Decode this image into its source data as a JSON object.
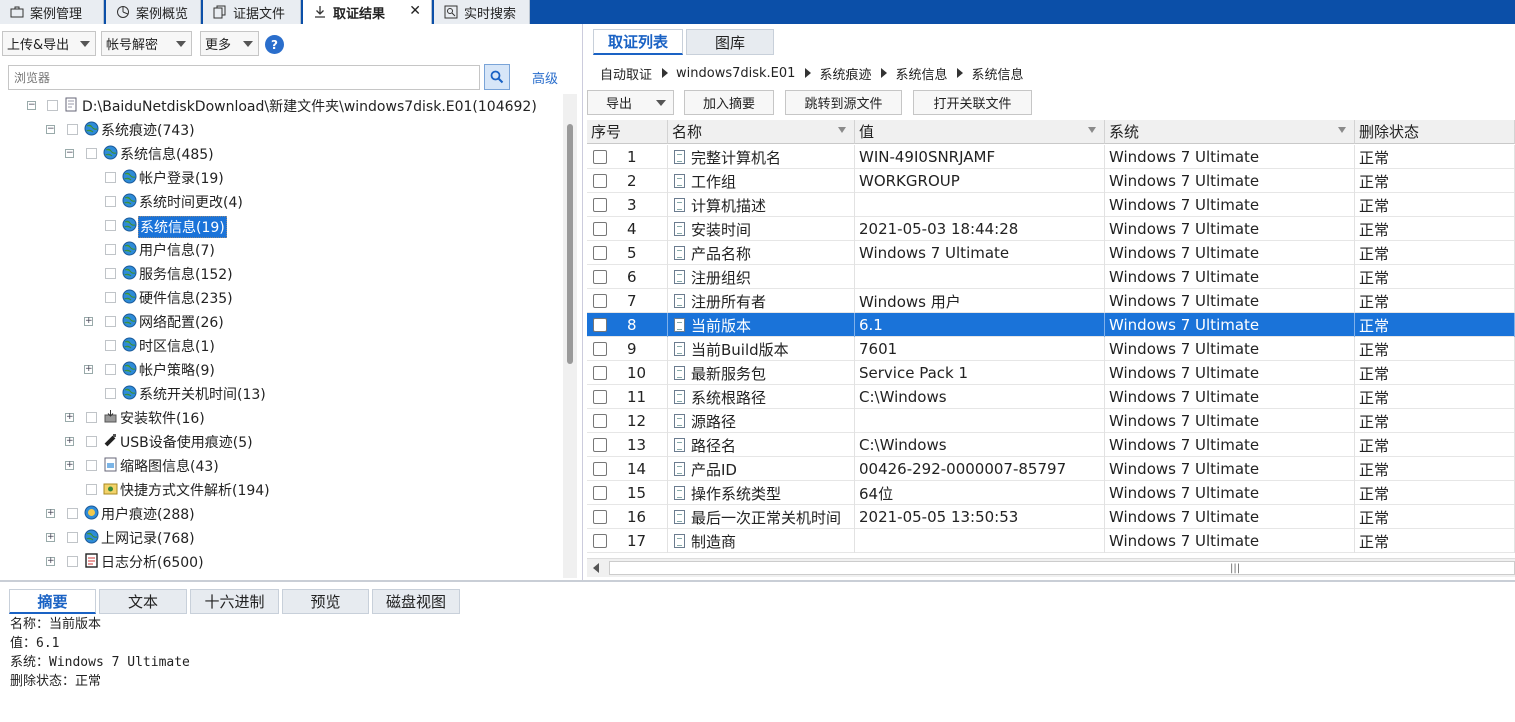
{
  "top_tabs": [
    {
      "label": "案例管理"
    },
    {
      "label": "案例概览"
    },
    {
      "label": "证据文件"
    },
    {
      "label": "取证结果",
      "close": "✕"
    },
    {
      "label": "实时搜索"
    }
  ],
  "left_toolbar": {
    "upload_export": "上传&导出",
    "account_decrypt": "帐号解密",
    "more": "更多",
    "help": "?"
  },
  "search": {
    "placeholder": "浏览器",
    "advanced": "高级"
  },
  "tree": [
    {
      "label": "D:\\BaiduNetdiskDownload\\新建文件夹\\windows7disk.E01(104692)",
      "expander": "−",
      "icon": "disk-icon"
    },
    {
      "label": "系统痕迹(743)",
      "expander": "−",
      "icon": "globe-icon"
    },
    {
      "label": "系统信息(485)",
      "expander": "−",
      "icon": "globe-icon"
    },
    {
      "label": "帐户登录(19)",
      "icon": "globe-icon"
    },
    {
      "label": "系统时间更改(4)",
      "icon": "globe-icon"
    },
    {
      "label": "系统信息(19)",
      "icon": "globe-icon",
      "selected": true
    },
    {
      "label": "用户信息(7)",
      "icon": "globe-icon"
    },
    {
      "label": "服务信息(152)",
      "icon": "globe-icon"
    },
    {
      "label": "硬件信息(235)",
      "icon": "globe-icon"
    },
    {
      "label": "网络配置(26)",
      "expander": "+",
      "icon": "globe-icon"
    },
    {
      "label": "时区信息(1)",
      "icon": "globe-icon"
    },
    {
      "label": "帐户策略(9)",
      "expander": "+",
      "icon": "globe-icon"
    },
    {
      "label": "系统开关机时间(13)",
      "icon": "globe-icon"
    },
    {
      "label": "安装软件(16)",
      "expander": "+",
      "icon": "installer-icon"
    },
    {
      "label": "USB设备使用痕迹(5)",
      "expander": "+",
      "icon": "usb-icon"
    },
    {
      "label": "缩略图信息(43)",
      "expander": "+",
      "icon": "thumbnail-icon"
    },
    {
      "label": "快捷方式文件解析(194)",
      "icon": "shortcut-icon"
    },
    {
      "label": "用户痕迹(288)",
      "expander": "+",
      "icon": "user-globe-icon"
    },
    {
      "label": "上网记录(768)",
      "expander": "+",
      "icon": "globe-icon"
    },
    {
      "label": "日志分析(6500)",
      "expander": "+",
      "icon": "log-icon"
    }
  ],
  "right_tabs": [
    {
      "label": "取证列表"
    },
    {
      "label": "图库"
    }
  ],
  "breadcrumb": [
    "自动取证",
    "windows7disk.E01",
    "系统痕迹",
    "系统信息",
    "系统信息"
  ],
  "right_toolbar": {
    "export": "导出",
    "add_summary": "加入摘要",
    "goto_source": "跳转到源文件",
    "open_related": "打开关联文件"
  },
  "table": {
    "columns": [
      "序号",
      "名称",
      "值",
      "系统",
      "删除状态"
    ],
    "rows": [
      {
        "no": "1",
        "name": "完整计算机名",
        "value": "WIN-49I0SNRJAMF",
        "system": "Windows 7 Ultimate",
        "status": "正常"
      },
      {
        "no": "2",
        "name": "工作组",
        "value": "WORKGROUP",
        "system": "Windows 7 Ultimate",
        "status": "正常"
      },
      {
        "no": "3",
        "name": "计算机描述",
        "value": "",
        "system": "Windows 7 Ultimate",
        "status": "正常"
      },
      {
        "no": "4",
        "name": "安装时间",
        "value": "2021-05-03 18:44:28",
        "system": "Windows 7 Ultimate",
        "status": "正常"
      },
      {
        "no": "5",
        "name": "产品名称",
        "value": "Windows 7 Ultimate",
        "system": "Windows 7 Ultimate",
        "status": "正常"
      },
      {
        "no": "6",
        "name": "注册组织",
        "value": "",
        "system": "Windows 7 Ultimate",
        "status": "正常"
      },
      {
        "no": "7",
        "name": "注册所有者",
        "value": "Windows 用户",
        "system": "Windows 7 Ultimate",
        "status": "正常"
      },
      {
        "no": "8",
        "name": "当前版本",
        "value": "6.1",
        "system": "Windows 7 Ultimate",
        "status": "正常",
        "selected": true
      },
      {
        "no": "9",
        "name": "当前Build版本",
        "value": "7601",
        "system": "Windows 7 Ultimate",
        "status": "正常"
      },
      {
        "no": "10",
        "name": "最新服务包",
        "value": "Service Pack 1",
        "system": "Windows 7 Ultimate",
        "status": "正常"
      },
      {
        "no": "11",
        "name": "系统根路径",
        "value": "C:\\Windows",
        "system": "Windows 7 Ultimate",
        "status": "正常"
      },
      {
        "no": "12",
        "name": "源路径",
        "value": "",
        "system": "Windows 7 Ultimate",
        "status": "正常"
      },
      {
        "no": "13",
        "name": "路径名",
        "value": "C:\\Windows",
        "system": "Windows 7 Ultimate",
        "status": "正常"
      },
      {
        "no": "14",
        "name": "产品ID",
        "value": "00426-292-0000007-85797",
        "system": "Windows 7 Ultimate",
        "status": "正常"
      },
      {
        "no": "15",
        "name": "操作系统类型",
        "value": "64位",
        "system": "Windows 7 Ultimate",
        "status": "正常"
      },
      {
        "no": "16",
        "name": "最后一次正常关机时间",
        "value": "2021-05-05 13:50:53",
        "system": "Windows 7 Ultimate",
        "status": "正常"
      },
      {
        "no": "17",
        "name": "制造商",
        "value": "",
        "system": "Windows 7 Ultimate",
        "status": "正常"
      }
    ]
  },
  "bottom_tabs": [
    {
      "label": "摘要"
    },
    {
      "label": "文本"
    },
    {
      "label": "十六进制"
    },
    {
      "label": "预览"
    },
    {
      "label": "磁盘视图"
    }
  ],
  "detail": [
    "名称：当前版本",
    "值：6.1",
    "系统：Windows 7 Ultimate",
    "删除状态：正常"
  ],
  "colors": {
    "top_bar": "#0b4fa8",
    "selection": "#1a73d9",
    "accent": "#1a62c4"
  }
}
